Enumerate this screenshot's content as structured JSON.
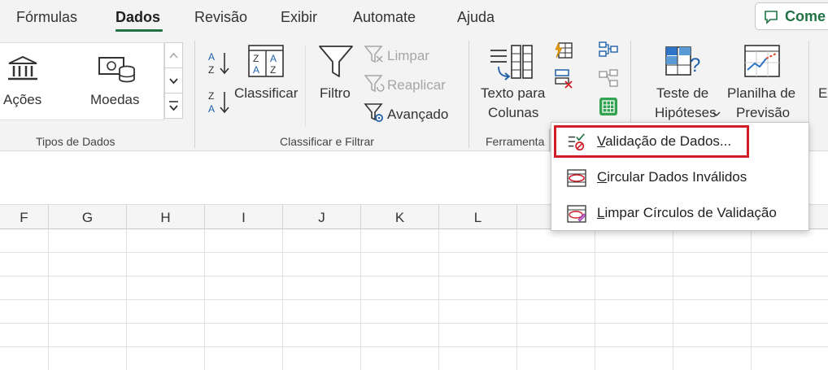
{
  "tabs": [
    {
      "label": "Fórmulas"
    },
    {
      "label": "Dados",
      "active": true
    },
    {
      "label": "Revisão"
    },
    {
      "label": "Exibir"
    },
    {
      "label": "Automate"
    },
    {
      "label": "Ajuda"
    }
  ],
  "comments_button": {
    "label": "Come"
  },
  "ribbon": {
    "data_types": {
      "acoes": "Ações",
      "moedas": "Moedas",
      "group_label": "Tipos de Dados"
    },
    "sort_filter": {
      "classificar": "Classificar",
      "filtro": "Filtro",
      "limpar": "Limpar",
      "reaplicar": "Reaplicar",
      "avancado": "Avançado",
      "group_label": "Classificar e Filtrar"
    },
    "data_tools": {
      "texto_para_line1": "Texto para",
      "texto_para_line2": "Colunas",
      "group_label": "Ferramenta"
    },
    "forecast": {
      "teste_line1": "Teste de",
      "teste_line2": "Hipóteses",
      "planilha_line1": "Planilha de",
      "planilha_line2": "Previsão",
      "cut_label": "Es"
    }
  },
  "columns": [
    "F",
    "G",
    "H",
    "I",
    "J",
    "K",
    "L"
  ],
  "validation_menu": {
    "items": [
      {
        "label": "Validação de Dados...",
        "underline": "V",
        "rest": "alidação de Dados...",
        "icon": "data-validation-icon",
        "highlighted": true
      },
      {
        "label": "Circular Dados Inválidos",
        "underline": "C",
        "rest": "ircular Dados Inválidos",
        "icon": "circle-invalid-icon"
      },
      {
        "label": "Limpar Círculos de Validação",
        "underline": "L",
        "rest": "impar Círculos de Validação",
        "icon": "clear-circles-icon"
      }
    ],
    "highlight_color": "#d11d28"
  },
  "colors": {
    "accent": "#217346",
    "ribbon_bg": "#f3f3f3"
  }
}
